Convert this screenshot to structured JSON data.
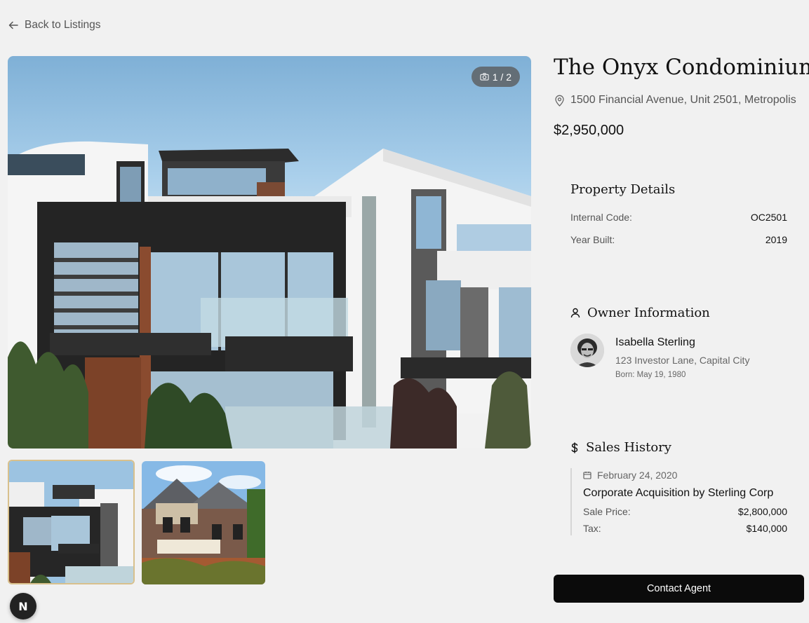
{
  "nav": {
    "back_label": "Back to Listings"
  },
  "gallery": {
    "counter": "1 / 2"
  },
  "property": {
    "title": "The Onyx Condominium",
    "address": "1500 Financial Avenue, Unit 2501, Metropolis",
    "price": "$2,950,000"
  },
  "details": {
    "heading": "Property Details",
    "rows": [
      {
        "label": "Internal Code:",
        "value": "OC2501"
      },
      {
        "label": "Year Built:",
        "value": "2019"
      }
    ]
  },
  "owner": {
    "heading": "Owner Information",
    "name": "Isabella Sterling",
    "address": "123 Investor Lane, Capital City",
    "born": "Born: May 19, 1980"
  },
  "sales": {
    "heading": "Sales History",
    "entries": [
      {
        "date": "February 24, 2020",
        "title": "Corporate Acquisition by Sterling Corp",
        "price_label": "Sale Price:",
        "price_value": "$2,800,000",
        "tax_label": "Tax:",
        "tax_value": "$140,000"
      }
    ]
  },
  "actions": {
    "contact_label": "Contact Agent"
  },
  "badge": {
    "letter": "N"
  },
  "icons": {
    "back": "arrow-left-icon",
    "camera": "camera-icon",
    "location": "map-pin-icon",
    "user": "user-icon",
    "dollar": "dollar-icon",
    "calendar": "calendar-icon"
  }
}
